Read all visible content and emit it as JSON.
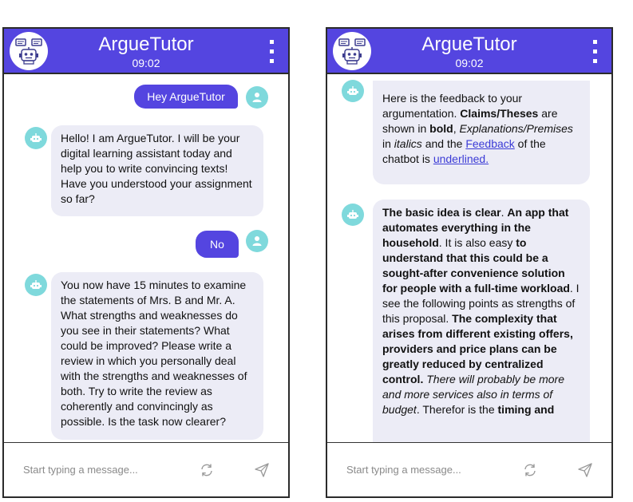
{
  "app": {
    "title": "ArgueTutor",
    "time": "09:02"
  },
  "input": {
    "placeholder": "Start typing a message..."
  },
  "left_chat": {
    "msg1_user": "Hey ArgueTutor",
    "msg2_bot": "Hello! I am ArgueTutor. I will be your digital learning assistant today and help you to write convincing texts! Have you understood your assignment so far?",
    "msg3_user": "No",
    "msg4_bot": "You now have 15 minutes to examine the statements of Mrs. B and Mr. A. What strengths and weaknesses do you see in their statements? What could be improved? Please write a review in which you personally deal with the strengths and weaknesses of both. Try to write the review as coherently and convincingly as possible. Is the task now clearer?"
  },
  "right_chat": {
    "fb": {
      "t1": "Here is the feedback to your argumentation. ",
      "t2": "Claims/Theses",
      "t3": " are shown in ",
      "t4": "bold",
      "t5": ", ",
      "t6": "Explanations/Premises",
      "t7": " in ",
      "t8": "italics",
      "t9": " and the ",
      "t10": "Feedback",
      "t11": " of the chatbot is ",
      "t12": "underlined."
    },
    "m2": {
      "s1": "The basic idea is clear",
      "s2": ". ",
      "s3": "An app that automates everything in the household",
      "s4": ". It is also easy ",
      "s5": "to understand that this could be a sought-after convenience solution for people with a full-time workload",
      "s6": ". I see the following points as strengths of this proposal. ",
      "s7": "The complexity that arises from different existing offers, providers and price plans can be greatly reduced by centralized control.",
      "s8": " ",
      "s9": "There will probably be more and more services also in terms of budget",
      "s10": ". Therefor is the ",
      "s11": "timing and"
    }
  },
  "icons": {
    "header_avatar": "robot-chat-icon",
    "bot_avatar": "robot-icon",
    "user_avatar": "user-icon",
    "menu": "kebab-menu-icon",
    "refresh": "refresh-icon",
    "send": "send-icon"
  },
  "colors": {
    "header": "#5445e0",
    "user_bubble": "#5445e0",
    "bot_bubble": "#ececf6",
    "avatar": "#7fd9dc",
    "link": "#3b3bd6"
  }
}
